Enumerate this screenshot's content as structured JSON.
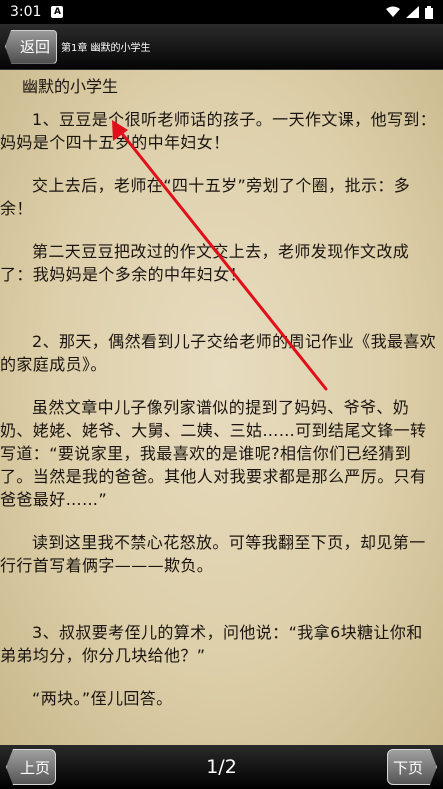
{
  "status_bar": {
    "time": "3:01",
    "notification_badge": "A",
    "icons": [
      "wifi-icon",
      "signal-icon",
      "battery-icon"
    ]
  },
  "header": {
    "back_label": "返回",
    "chapter_title": "第1章 幽默的小学生"
  },
  "content": {
    "title": "幽默的小学生",
    "paragraphs": [
      "1、豆豆是个很听老师话的孩子。一天作文课，他写到：妈妈是个四十五岁的中年妇女！",
      "交上去后，老师在“四十五岁”旁划了个圈，批示：多余！",
      "第二天豆豆把改过的作文交上去，老师发现作文改成了：我妈妈是个多余的中年妇女！",
      "2、那天，偶然看到儿子交给老师的周记作业《我最喜欢的家庭成员》。",
      "虽然文章中儿子像列家谱似的提到了妈妈、爷爷、奶奶、姥姥、姥爷、大舅、二姨、三姑……可到结尾文锋一转写道：“要说家里，我最喜欢的是谁呢?相信你们已经猜到了。当然是我的爸爸。其他人对我要求都是那么严厉。只有爸爸最好……”",
      "读到这里我不禁心花怒放。可等我翻至下页，却见第一行行首写着俩字———欺负。",
      "3、叔叔要考侄儿的算术，问他说：“我拿6块糖让你和弟弟均分，你分几块给他？”",
      "“两块。”侄儿回答。"
    ]
  },
  "footer": {
    "prev_label": "上页",
    "next_label": "下页",
    "page_indicator": "1/2"
  },
  "colors": {
    "paper": "#ddcfa9",
    "text": "#1a1410",
    "arrow": "#e0101a",
    "bar": "#000000"
  }
}
